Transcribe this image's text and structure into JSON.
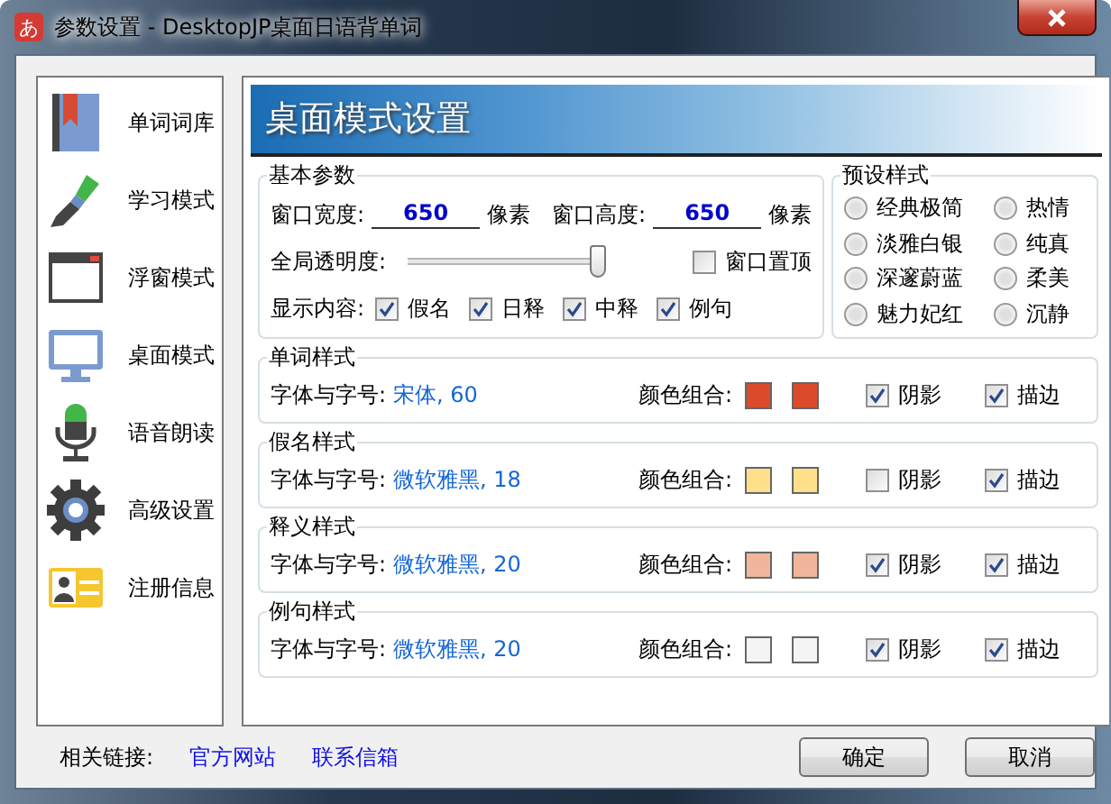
{
  "window": {
    "title": "参数设置 - DesktopJP桌面日语背单词",
    "app_icon": "あ"
  },
  "sidebar": {
    "items": [
      {
        "label": "单词词库",
        "kind": "book"
      },
      {
        "label": "学习模式",
        "kind": "brush"
      },
      {
        "label": "浮窗模式",
        "kind": "window"
      },
      {
        "label": "桌面模式",
        "kind": "monitor"
      },
      {
        "label": "语音朗读",
        "kind": "mic"
      },
      {
        "label": "高级设置",
        "kind": "gear"
      },
      {
        "label": "注册信息",
        "kind": "card"
      }
    ]
  },
  "panel": {
    "title": "桌面模式设置",
    "basic": {
      "title": "基本参数",
      "width_label": "窗口宽度:",
      "width_value": "650",
      "width_unit": "像素",
      "height_label": "窗口高度:",
      "height_value": "650",
      "height_unit": "像素",
      "opacity_label": "全局透明度:",
      "opacity": {
        "level": 0.97
      },
      "topmost": {
        "label": "窗口置顶",
        "checked": false
      },
      "display_label": "显示内容:",
      "display_options": [
        {
          "label": "假名",
          "checked": true
        },
        {
          "label": "日释",
          "checked": true
        },
        {
          "label": "中释",
          "checked": true
        },
        {
          "label": "例句",
          "checked": true
        }
      ]
    },
    "presets": {
      "title": "预设样式",
      "options": [
        {
          "label": "经典极简",
          "selected": false
        },
        {
          "label": "热情",
          "selected": false
        },
        {
          "label": "淡雅白银",
          "selected": false
        },
        {
          "label": "纯真",
          "selected": false
        },
        {
          "label": "深邃蔚蓝",
          "selected": false
        },
        {
          "label": "柔美",
          "selected": false
        },
        {
          "label": "魅力妃红",
          "selected": false
        },
        {
          "label": "沉静",
          "selected": false
        }
      ]
    },
    "styles": [
      {
        "title": "单词样式",
        "font_label": "字体与字号:",
        "font_value": "宋体, 60",
        "color_label": "颜色组合:",
        "colors": [
          {
            "color": "#dc4a2c"
          },
          {
            "color": "#dc4a2c"
          }
        ],
        "shadow": {
          "label": "阴影",
          "checked": true
        },
        "outline": {
          "label": "描边",
          "checked": true
        }
      },
      {
        "title": "假名样式",
        "font_label": "字体与字号:",
        "font_value": "微软雅黑, 18",
        "color_label": "颜色组合:",
        "colors": [
          {
            "color": "#ffe08a"
          },
          {
            "color": "#ffe08a"
          }
        ],
        "shadow": {
          "label": "阴影",
          "checked": false
        },
        "outline": {
          "label": "描边",
          "checked": true
        }
      },
      {
        "title": "释义样式",
        "font_label": "字体与字号:",
        "font_value": "微软雅黑, 20",
        "color_label": "颜色组合:",
        "colors": [
          {
            "color": "#f0b59a"
          },
          {
            "color": "#f0b59a"
          }
        ],
        "shadow": {
          "label": "阴影",
          "checked": true
        },
        "outline": {
          "label": "描边",
          "checked": true
        }
      },
      {
        "title": "例句样式",
        "font_label": "字体与字号:",
        "font_value": "微软雅黑, 20",
        "color_label": "颜色组合:",
        "colors": [
          {
            "color": "#f4f4f4"
          },
          {
            "color": "#f4f4f4"
          }
        ],
        "shadow": {
          "label": "阴影",
          "checked": true
        },
        "outline": {
          "label": "描边",
          "checked": true
        }
      }
    ]
  },
  "footer": {
    "links_label": "相关链接:",
    "links": [
      "官方网站",
      "联系信箱"
    ],
    "buttons": [
      "确定",
      "取消"
    ]
  }
}
